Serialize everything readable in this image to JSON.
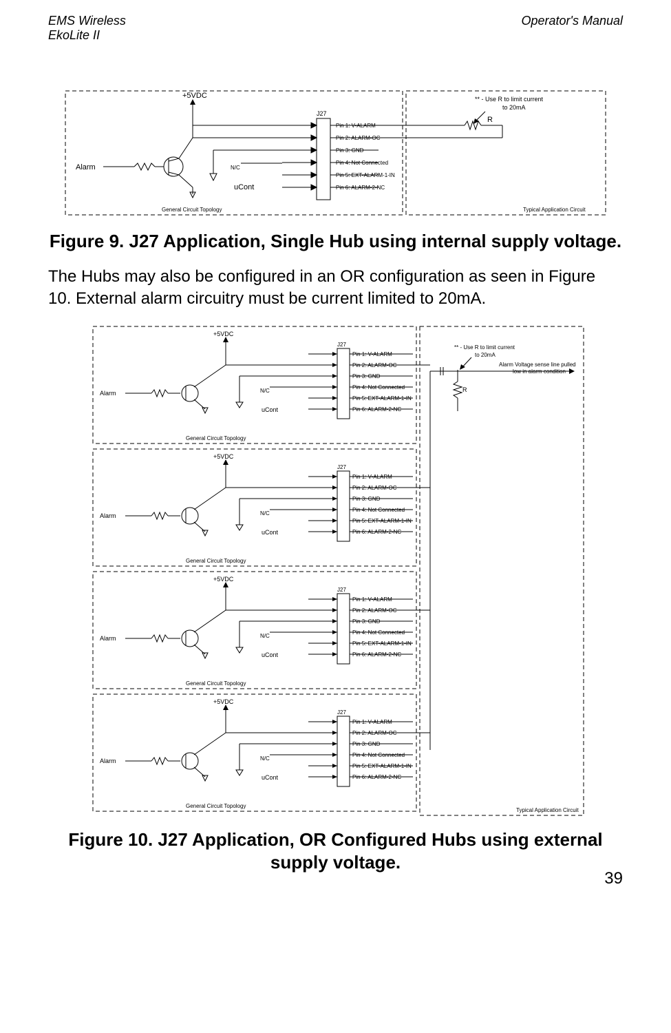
{
  "header": {
    "left_line1": "EMS Wireless",
    "left_line2": "EkoLite II",
    "right": "Operator's Manual"
  },
  "fig9_caption": "Figure 9. J27 Application, Single Hub using internal supply voltage.",
  "body_para": "The Hubs may also be configured in an OR configuration as seen in Figure 10.  External alarm circuitry must be current limited to 20mA.",
  "fig10_caption": "Figure 10. J27 Application, OR Configured Hubs using external supply voltage.",
  "page_number": "39",
  "diagram_common": {
    "vdc": "+5VDC",
    "alarm": "Alarm",
    "nc": "N/C",
    "ucont": "uCont",
    "j27": "J27",
    "gct": "General Circuit Topology",
    "tac": "Typical Application Circuit",
    "pins": {
      "p1": "Pin 1: V-ALARM",
      "p2": "Pin 2: ALARM-OC",
      "p3": "Pin 3: GND",
      "p4": "Pin 4: Not Connected",
      "p5": "Pin 5: EXT-ALARM-1-IN",
      "p6": "Pin 6: ALARM-2-NC"
    },
    "note_r": "** - Use R to limit current to 20mA",
    "note_r_line1": "** - Use R to limit current",
    "note_r_line2": "to 20mA",
    "r_label": "R",
    "sense_note_line1": "Alarm Voltage sense line pulled",
    "sense_note_line2": "low in alarm condition"
  }
}
